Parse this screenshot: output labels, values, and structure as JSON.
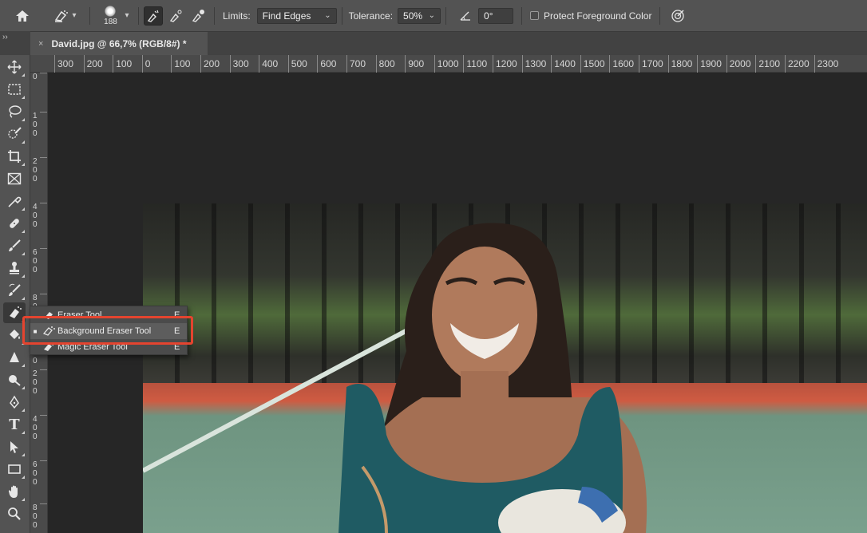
{
  "options_bar": {
    "home_icon": "home-icon",
    "tool_preset_icon": "background-eraser-icon",
    "brush_size": "188",
    "sampling_icons": [
      "sampling-continuous-icon",
      "sampling-once-icon",
      "sampling-swatch-icon"
    ],
    "limits_label": "Limits:",
    "limits_value": "Find Edges",
    "tolerance_label": "Tolerance:",
    "tolerance_value": "50%",
    "angle_value": "0°",
    "protect_label": "Protect Foreground Color",
    "pressure_icon": "pressure-size-icon"
  },
  "document": {
    "tab_title": "David.jpg @ 66,7% (RGB/8#) *",
    "close_glyph": "×",
    "collapse_glyph": "››"
  },
  "ruler_h": [
    "300",
    "200",
    "100",
    "0",
    "100",
    "200",
    "300",
    "400",
    "500",
    "600",
    "700",
    "800",
    "900",
    "1000",
    "1100",
    "1200",
    "1300",
    "1400",
    "1500",
    "1600",
    "1700",
    "1800",
    "1900",
    "2000",
    "2100",
    "2200",
    "2300"
  ],
  "ruler_v": [
    "0",
    "1\n0\n0",
    "2\n0\n0",
    "4\n0\n0",
    "6\n0\n0",
    "8\n0\n0",
    "1\n0\n0",
    "0",
    "2\n0\n0",
    "4\n0\n0",
    "6\n0\n0",
    "8\n0\n0"
  ],
  "tools": [
    {
      "name": "move-tool",
      "icon": "move-icon"
    },
    {
      "name": "marquee-tool",
      "icon": "marquee-icon"
    },
    {
      "name": "lasso-tool",
      "icon": "lasso-icon"
    },
    {
      "name": "quick-selection-tool",
      "icon": "quick-select-icon"
    },
    {
      "name": "crop-tool",
      "icon": "crop-icon"
    },
    {
      "name": "frame-tool",
      "icon": "frame-icon"
    },
    {
      "name": "eyedropper-tool",
      "icon": "eyedropper-icon"
    },
    {
      "name": "healing-brush-tool",
      "icon": "bandage-icon"
    },
    {
      "name": "brush-tool",
      "icon": "brush-icon"
    },
    {
      "name": "clone-stamp-tool",
      "icon": "stamp-icon"
    },
    {
      "name": "history-brush-tool",
      "icon": "history-brush-icon"
    },
    {
      "name": "eraser-tool",
      "icon": "eraser-icon"
    },
    {
      "name": "paint-bucket-tool",
      "icon": "bucket-icon"
    },
    {
      "name": "blur-tool",
      "icon": "blur-icon"
    },
    {
      "name": "dodge-tool",
      "icon": "dodge-icon"
    },
    {
      "name": "pen-tool",
      "icon": "pen-icon"
    },
    {
      "name": "type-tool",
      "icon": "type-icon"
    },
    {
      "name": "path-selection-tool",
      "icon": "arrow-icon"
    },
    {
      "name": "rectangle-tool",
      "icon": "rectangle-icon"
    },
    {
      "name": "hand-tool",
      "icon": "hand-icon"
    },
    {
      "name": "zoom-tool",
      "icon": "zoom-icon"
    }
  ],
  "type_tool_glyph": "T",
  "flyout": {
    "items": [
      {
        "label": "Eraser Tool",
        "shortcut": "E",
        "selected": false,
        "icon": "eraser-icon"
      },
      {
        "label": "Background Eraser Tool",
        "shortcut": "E",
        "selected": true,
        "icon": "background-eraser-icon"
      },
      {
        "label": "Magic Eraser Tool",
        "shortcut": "E",
        "selected": false,
        "icon": "magic-eraser-icon"
      }
    ],
    "selected_marker": "■",
    "highlight_color": "#e4442f"
  },
  "colors": {
    "panel": "#535353",
    "pasteboard": "#262626",
    "highlight": "#e4442f"
  }
}
